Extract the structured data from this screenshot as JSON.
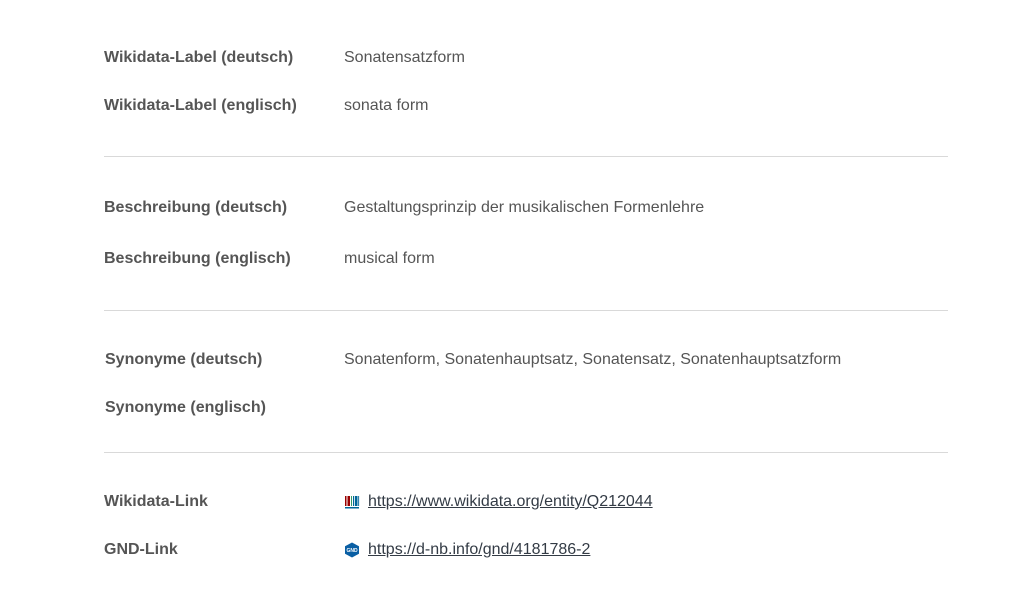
{
  "rows": {
    "wd_label_de": {
      "label": "Wikidata-Label (deutsch)",
      "value": "Sonatensatzform"
    },
    "wd_label_en": {
      "label": "Wikidata-Label (englisch)",
      "value": "sonata form"
    },
    "desc_de": {
      "label": "Beschreibung (deutsch)",
      "value": "Gestaltungsprinzip der musikalischen Formenlehre"
    },
    "desc_en": {
      "label": "Beschreibung (englisch)",
      "value": "musical form"
    },
    "syn_de": {
      "label": "Synonyme (deutsch)",
      "value": "Sonatenform, Sonatenhauptsatz, Sonatensatz, Sonatenhauptsatzform"
    },
    "syn_en": {
      "label": "Synonyme (englisch)",
      "value": ""
    },
    "wd_link": {
      "label": "Wikidata-Link",
      "url": "https://www.wikidata.org/entity/Q212044",
      "icon": "wikidata-icon"
    },
    "gnd_link": {
      "label": "GND-Link",
      "url": "https://d-nb.info/gnd/4181786-2",
      "icon": "gnd-icon",
      "icon_text": "GND"
    }
  },
  "colors": {
    "text": "#555555",
    "link": "#333b45",
    "divider": "#d9d9d9",
    "wikidata_red": "#990000",
    "wikidata_green": "#339966",
    "wikidata_blue": "#006699",
    "gnd_blue": "#0a5fa4"
  }
}
